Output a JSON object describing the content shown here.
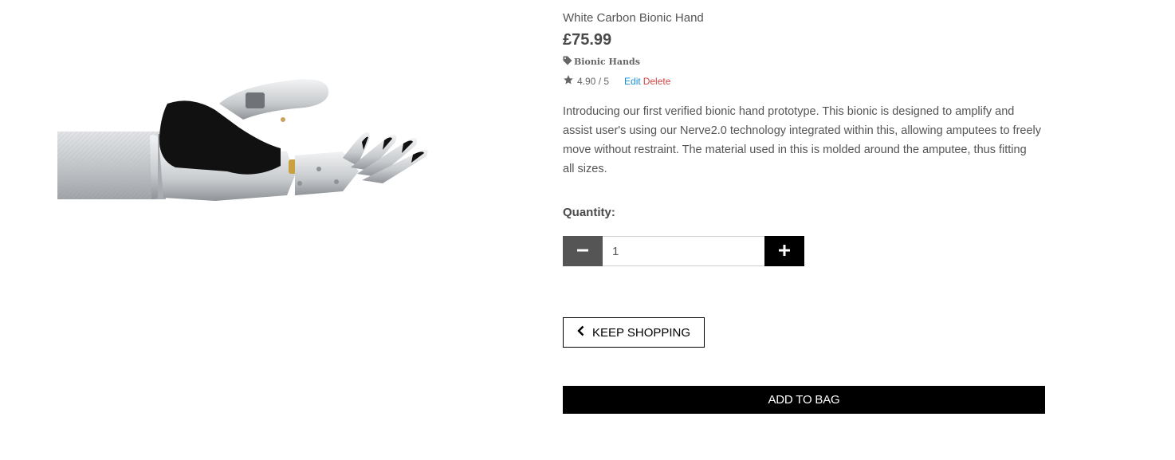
{
  "product": {
    "name": "White Carbon Bionic Hand",
    "price": "£75.99",
    "category": "Bionic Hands",
    "rating": "4.90 / 5",
    "edit_label": "Edit",
    "delete_label": "Delete",
    "description": "Introducing our first verified bionic hand prototype. This bionic is designed to amplify and assist user's using our Nerve2.0 technology integrated within this, allowing amputees to freely move without restraint. The material used in this is molded around the amputee, thus fitting all sizes.",
    "image_alt": "White Carbon Bionic Hand"
  },
  "quantity": {
    "label": "Quantity:",
    "value": "1"
  },
  "actions": {
    "keep_shopping_label": "KEEP SHOPPING",
    "add_to_bag_label": "ADD TO BAG"
  },
  "icons": {
    "tag": "tag-icon",
    "star": "star-icon",
    "minus": "minus-icon",
    "plus": "plus-icon",
    "back": "chevron-left-icon"
  },
  "colors": {
    "edit_link": "#1a8fd8",
    "delete_link": "#d64545",
    "minus_button": "#555555",
    "plus_button": "#000000",
    "add_to_bag_button": "#000000"
  }
}
